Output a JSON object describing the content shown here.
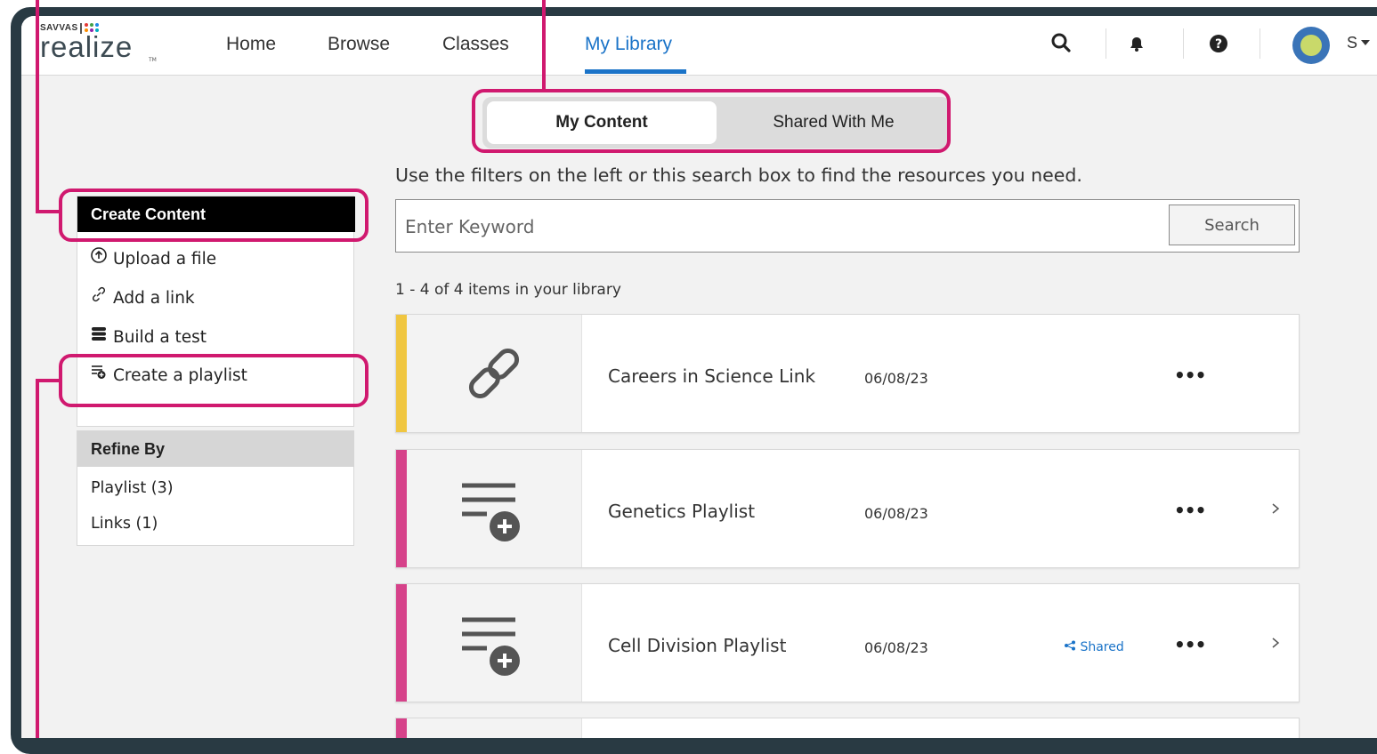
{
  "brand": {
    "top": "SAVVAS",
    "word": "realize",
    "tm": "TM"
  },
  "nav": {
    "home": "Home",
    "browse": "Browse",
    "classes": "Classes",
    "my_library": "My Library"
  },
  "user": {
    "initial": "S"
  },
  "tabs": {
    "my_content": "My Content",
    "shared_with_me": "Shared With Me"
  },
  "hint": "Use the filters on the left or this search box to find the resources you need.",
  "search": {
    "placeholder": "Enter Keyword",
    "button": "Search"
  },
  "count": "1 - 4 of 4 items in your library",
  "create_content": {
    "header": "Create Content",
    "items": [
      "Upload a file",
      "Add a link",
      "Build a test",
      "Create a playlist"
    ]
  },
  "refine": {
    "header": "Refine By",
    "items": [
      "Playlist (3)",
      "Links (1)"
    ]
  },
  "cards": [
    {
      "title": "Careers in Science Link",
      "date": "06/08/23",
      "shared": "",
      "more": "•••"
    },
    {
      "title": "Genetics Playlist",
      "date": "06/08/23",
      "shared": "",
      "more": "•••"
    },
    {
      "title": "Cell Division Playlist",
      "date": "06/08/23",
      "shared": "Shared",
      "more": "•••"
    }
  ],
  "colors": {
    "accent": "#1a73c8",
    "highlight": "#d0196f",
    "link_stripe": "#f0c640",
    "playlist_stripe": "#d6428a",
    "frame": "#293a43"
  },
  "icons": [
    "search-icon",
    "bell-icon",
    "help-icon",
    "avatar",
    "upload-icon",
    "link-icon",
    "test-icon",
    "playlist-icon",
    "chevron-right-icon",
    "share-icon"
  ]
}
